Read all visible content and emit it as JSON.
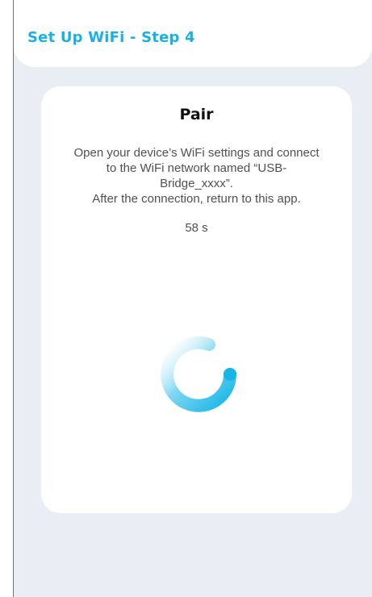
{
  "header": {
    "title": "Set Up WiFi - Step 4"
  },
  "card": {
    "title": "Pair",
    "description_lines": [
      "Open your device’s WiFi settings and connect",
      "to the WiFi network named “USB-",
      "Bridge_xxxx”.",
      "After the connection, return to this app."
    ],
    "countdown": "58 s"
  },
  "colors": {
    "accent": "#1ab0e5",
    "background": "#e9eef4",
    "card": "#ffffff",
    "text": "#505050",
    "title": "#111111"
  },
  "icons": {
    "spinner": "loading-spinner-icon"
  }
}
